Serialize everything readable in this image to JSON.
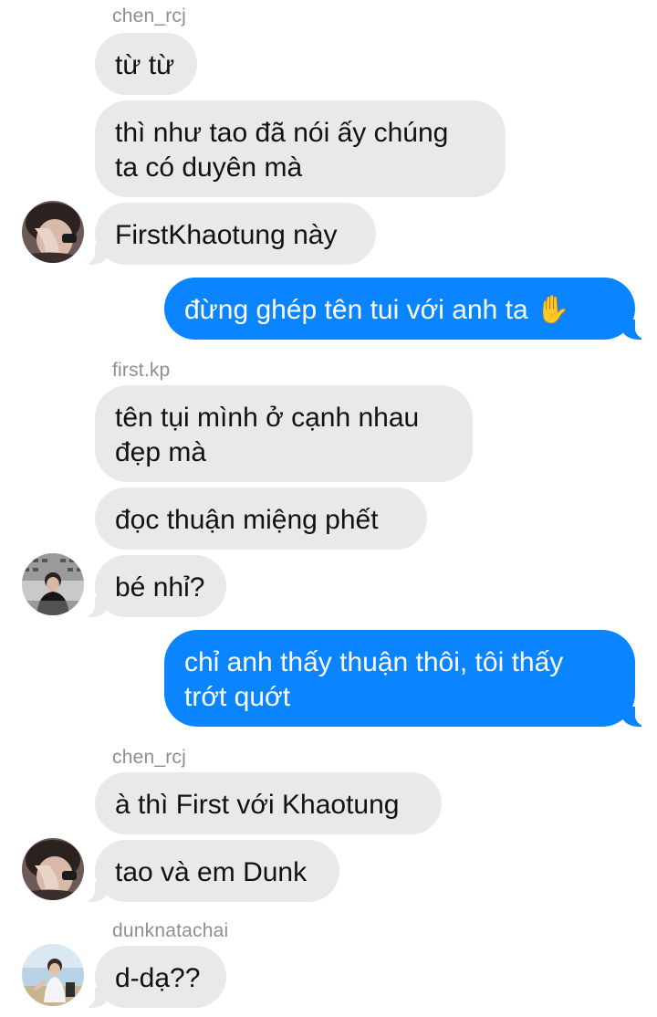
{
  "messages": [
    {
      "sender": "chen_rcj"
    },
    {
      "text": "từ từ"
    },
    {
      "text": "thì như tao đã nói ấy chúng\nta có duyên mà"
    },
    {
      "text": "FirstKhaotung này"
    },
    {
      "text": "đừng ghép tên tui với anh ta ✋"
    },
    {
      "sender": "first.kp"
    },
    {
      "text": "tên tụi mình ở cạnh nhau\nđẹp mà"
    },
    {
      "text": "đọc thuận miệng phết"
    },
    {
      "text": "bé nhỉ?"
    },
    {
      "text": "chỉ anh thấy thuận thôi, tôi thấy\ntrớt quớt"
    },
    {
      "sender": "chen_rcj"
    },
    {
      "text": "à thì First với Khaotung"
    },
    {
      "text": "tao và em Dunk"
    },
    {
      "sender": "dunknatachai"
    },
    {
      "text": "d-dạ??"
    }
  ],
  "colors": {
    "incoming_bubble": "#e9e9eb",
    "outgoing_bubble": "#0a84ff",
    "sender_label": "#8e8e93"
  },
  "icons": [
    "raised-hand-emoji",
    "avatar-chen-rcj",
    "avatar-first-kp",
    "avatar-dunknatachai"
  ]
}
